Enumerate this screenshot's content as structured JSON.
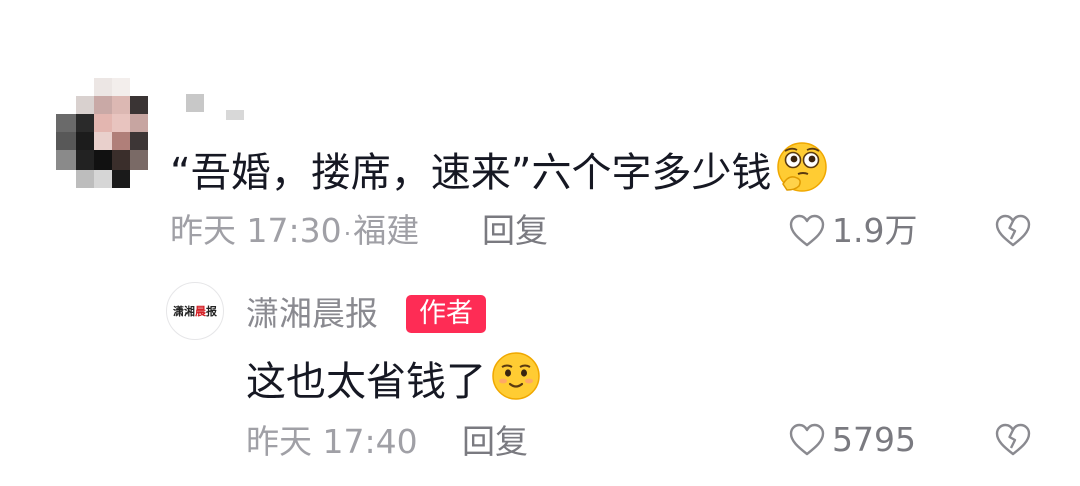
{
  "comment": {
    "text": "“吾婚，搂席，速来”六个字多少钱",
    "emoji_icon": "thinking-face-icon",
    "time": "昨天 17:30",
    "separator": "·",
    "location": "福建",
    "reply_label": "回复",
    "likes": "1.9万"
  },
  "reply": {
    "avatar_text": [
      "潇湘",
      "晨",
      "报"
    ],
    "author_name": "潇湘晨报",
    "badge": "作者",
    "text": "这也太省钱了",
    "emoji_icon": "smug-face-icon",
    "time": "昨天 17:40",
    "reply_label": "回复",
    "likes": "5795"
  },
  "colors": {
    "text_primary": "#161823",
    "text_secondary": "#a0a0a6",
    "badge_bg": "#fe2c55"
  }
}
